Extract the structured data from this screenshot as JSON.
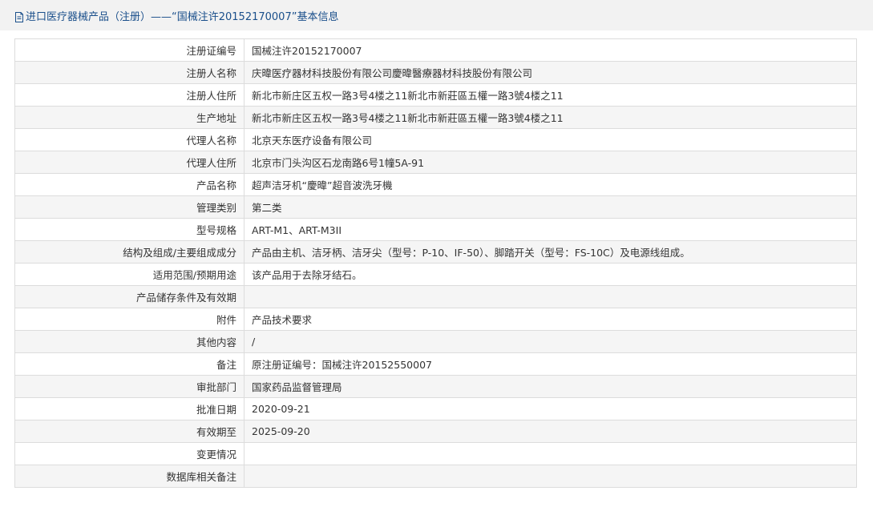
{
  "header": {
    "title": "进口医疗器械产品（注册）——“国械注许20152170007”基本信息",
    "icon": "document-icon"
  },
  "rows": [
    {
      "label": "注册证编号",
      "value": "国械注许20152170007"
    },
    {
      "label": "注册人名称",
      "value": "庆暐医疗器材科技股份有限公司慶暐醫療器材科技股份有限公司"
    },
    {
      "label": "注册人住所",
      "value": "新北市新庄区五权一路3号4楼之11新北市新莊區五權一路3號4楼之11"
    },
    {
      "label": "生产地址",
      "value": "新北市新庄区五权一路3号4楼之11新北市新莊區五權一路3號4楼之11"
    },
    {
      "label": "代理人名称",
      "value": "北京天东医疗设备有限公司"
    },
    {
      "label": "代理人住所",
      "value": "北京市门头沟区石龙南路6号1幢5A-91"
    },
    {
      "label": "产品名称",
      "value": "超声洁牙机“慶暐”超音波洗牙機"
    },
    {
      "label": "管理类别",
      "value": "第二类"
    },
    {
      "label": "型号规格",
      "value": "ART-M1、ART-M3ⅠⅠ"
    },
    {
      "label": "结构及组成/主要组成成分",
      "value": "产品由主机、洁牙柄、洁牙尖（型号：P-10、ⅠF-50）、脚踏开关（型号：FS-10C）及电源线组成。"
    },
    {
      "label": "适用范围/预期用途",
      "value": "该产品用于去除牙结石。"
    },
    {
      "label": "产品储存条件及有效期",
      "value": ""
    },
    {
      "label": "附件",
      "value": "产品技术要求"
    },
    {
      "label": "其他内容",
      "value": "/"
    },
    {
      "label": "备注",
      "value": "原注册证编号：国械注许20152550007"
    },
    {
      "label": "审批部门",
      "value": "国家药品监督管理局"
    },
    {
      "label": "批准日期",
      "value": "2020-09-21"
    },
    {
      "label": "有效期至",
      "value": "2025-09-20"
    },
    {
      "label": "变更情况",
      "value": ""
    },
    {
      "label": "数据库相关备注",
      "value": ""
    }
  ]
}
